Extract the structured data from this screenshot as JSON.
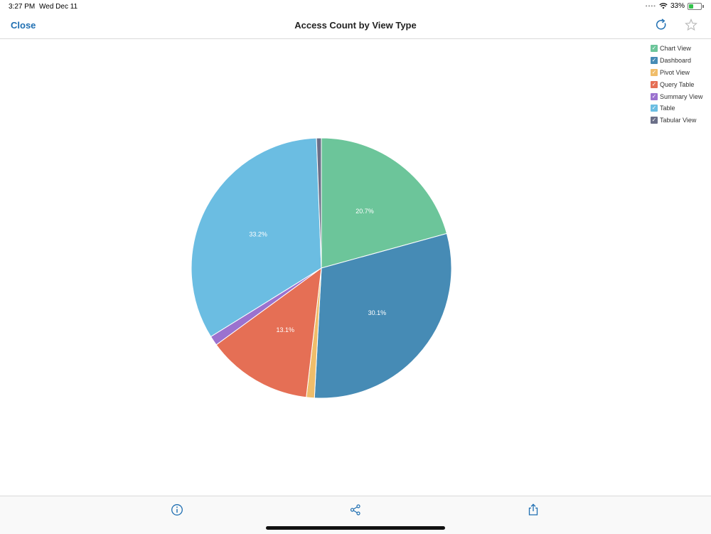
{
  "status": {
    "time": "3:27 PM",
    "date": "Wed Dec 11",
    "battery": "33%",
    "battery_level": 0.33
  },
  "nav": {
    "close_label": "Close",
    "title": "Access Count by View Type",
    "icons": [
      "refresh-icon",
      "star-icon"
    ]
  },
  "legend": [
    {
      "label": "Chart View",
      "color": "#6cc59a"
    },
    {
      "label": "Dashboard",
      "color": "#468bb5"
    },
    {
      "label": "Pivot View",
      "color": "#f0bd6a"
    },
    {
      "label": "Query Table",
      "color": "#e56f55"
    },
    {
      "label": "Summary View",
      "color": "#9b72cf"
    },
    {
      "label": "Table",
      "color": "#6bbde2"
    },
    {
      "label": "Tabular View",
      "color": "#6b6f88"
    }
  ],
  "chart_data": {
    "type": "pie",
    "categories": [
      "Chart View",
      "Dashboard",
      "Pivot View",
      "Query Table",
      "Summary View",
      "Table",
      "Tabular View"
    ],
    "values": [
      20.7,
      30.1,
      1.0,
      13.1,
      1.2,
      33.2,
      0.6
    ],
    "labels": [
      "20.7%",
      "30.1%",
      "",
      "13.1%",
      "",
      "33.2%",
      ""
    ],
    "legend_placement": "top-right"
  },
  "bottom": {
    "icons": [
      "info-icon",
      "share-network-icon",
      "export-icon"
    ]
  }
}
